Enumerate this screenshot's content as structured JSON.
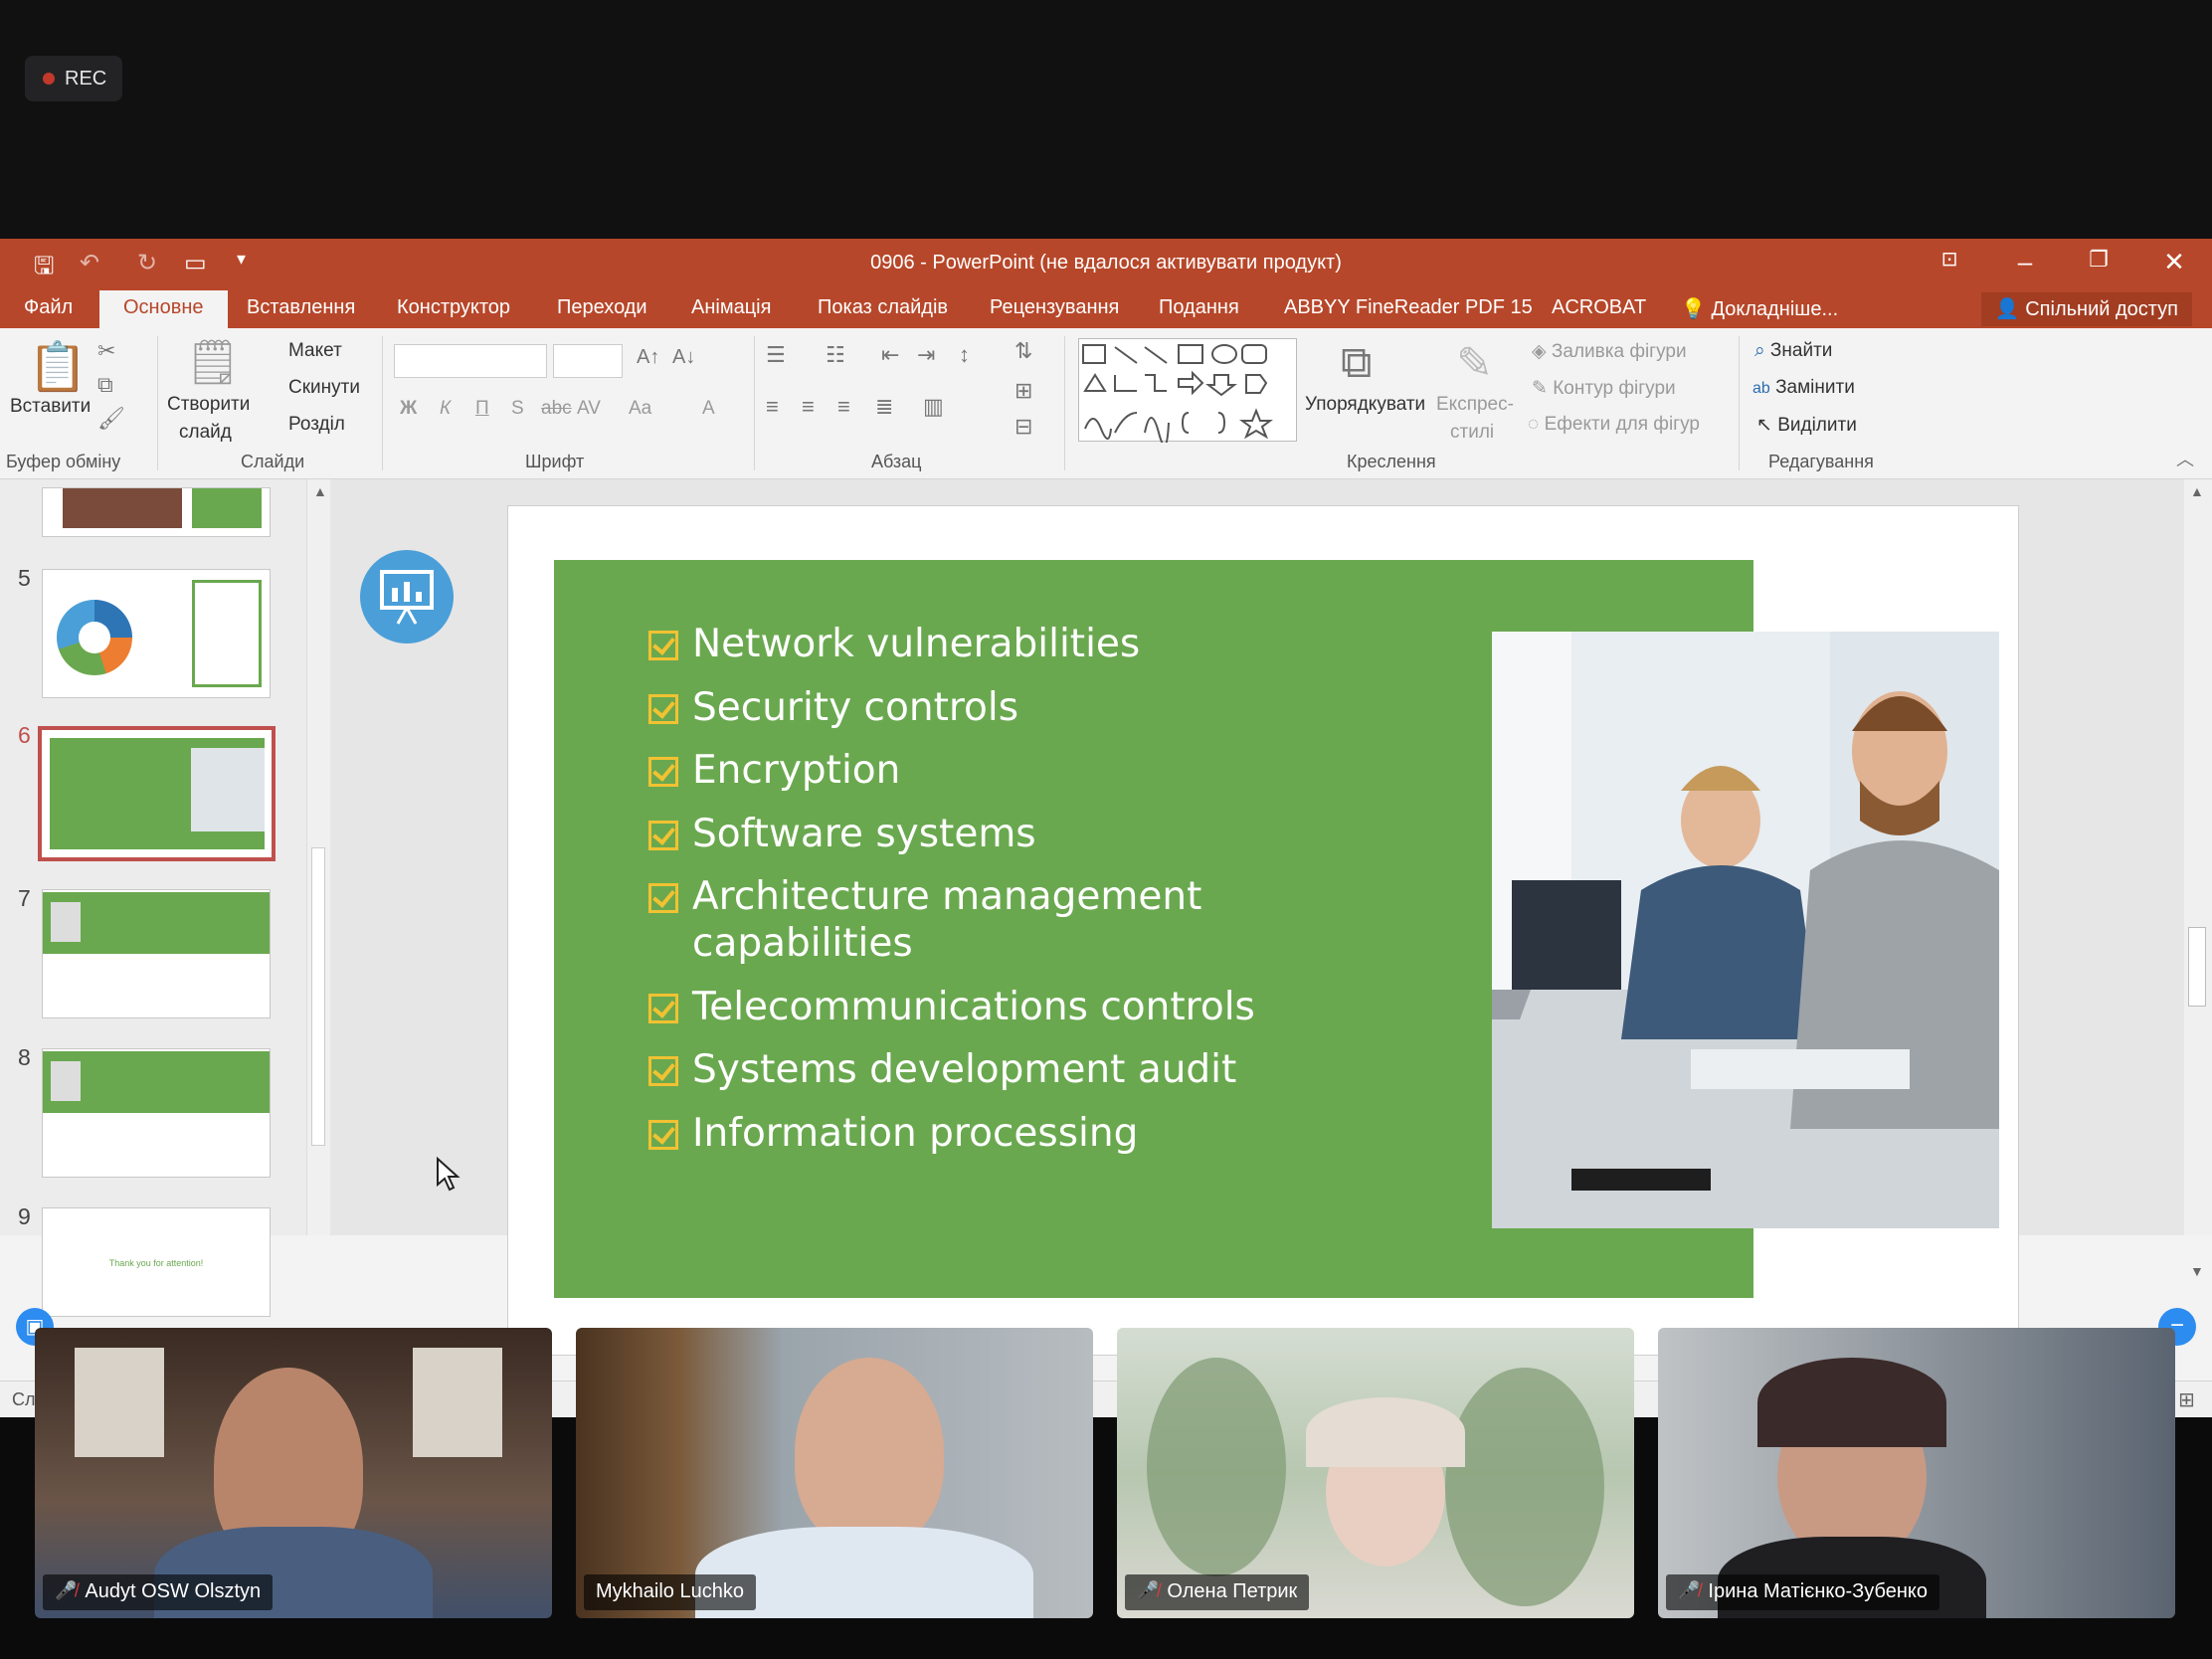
{
  "recording": {
    "label": "REC"
  },
  "window": {
    "title": "0906 - PowerPoint (не вдалося активувати продукт)"
  },
  "tabs": [
    {
      "label": "Файл"
    },
    {
      "label": "Основне"
    },
    {
      "label": "Вставлення"
    },
    {
      "label": "Конструктор"
    },
    {
      "label": "Переходи"
    },
    {
      "label": "Анімація"
    },
    {
      "label": "Показ слайдів"
    },
    {
      "label": "Рецензування"
    },
    {
      "label": "Подання"
    },
    {
      "label": "ABBYY FineReader PDF 15"
    },
    {
      "label": "ACROBAT"
    },
    {
      "label": "Докладніше..."
    }
  ],
  "share_label": "Спільний доступ",
  "ribbon": {
    "paste": "Вставити",
    "new_slide_1": "Створити",
    "new_slide_2": "слайд",
    "layout": "Макет",
    "reset": "Скинути",
    "section": "Розділ",
    "arrange": "Упорядкувати",
    "quick_styles_1": "Експрес-",
    "quick_styles_2": "стилі",
    "shape_fill": "Заливка фігури",
    "shape_outline": "Контур фігури",
    "shape_effects": "Ефекти для фігур",
    "find": "Знайти",
    "replace": "Замінити",
    "select": "Виділити",
    "bold": "Ж",
    "italic": "К",
    "underline": "П",
    "shadow": "S",
    "strike": "abc",
    "spacing": "AV",
    "case": "Aa",
    "color": "A",
    "groups": {
      "clipboard": "Буфер обміну",
      "slides": "Слайди",
      "font": "Шрифт",
      "paragraph": "Абзац",
      "drawing": "Креслення",
      "editing": "Редагування"
    }
  },
  "thumbnails": {
    "numbers": [
      "5",
      "6",
      "7",
      "8",
      "9"
    ],
    "slide9_text": "Thank you for attention!"
  },
  "slide": {
    "bullets": [
      "Network vulnerabilities",
      "Security controls",
      "Encryption",
      "Software systems",
      "Architecture management capabilities",
      "Telecommunications controls",
      "Systems development audit",
      "Information processing"
    ]
  },
  "status_stub": "Сл",
  "participants": [
    {
      "name": "Audyt OSW Olsztyn",
      "muted": true
    },
    {
      "name": "Mykhailo Luchko",
      "muted": false
    },
    {
      "name": "Олена Петрик",
      "muted": true
    },
    {
      "name": "Ірина Матієнко-Зубенко",
      "muted": true
    }
  ],
  "colors": {
    "ppt_accent": "#b7472a",
    "slide_green": "#6aa84f",
    "checkbox_yellow": "#f1c232",
    "selected_thumb_border": "#c0504d"
  }
}
